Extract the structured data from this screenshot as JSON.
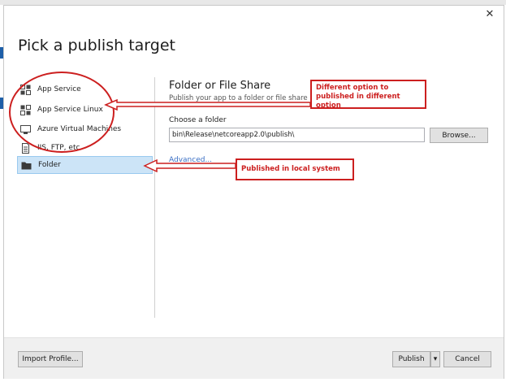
{
  "dialog": {
    "title": "Pick a publish target",
    "close_glyph": "✕"
  },
  "targets": [
    {
      "label": "App Service",
      "icon": "app-service-icon"
    },
    {
      "label": "App Service Linux",
      "icon": "app-service-linux-icon"
    },
    {
      "label": "Azure Virtual Machines",
      "icon": "virtual-machine-icon"
    },
    {
      "label": "IIS, FTP, etc",
      "icon": "document-icon"
    },
    {
      "label": "Folder",
      "icon": "folder-icon",
      "selected": true
    }
  ],
  "detail": {
    "title": "Folder or File Share",
    "subtitle": "Publish your app to a folder or file share",
    "folder_label": "Choose a folder",
    "folder_value": "bin\\Release\\netcoreapp2.0\\publish\\",
    "browse_label": "Browse...",
    "advanced_label": "Advanced..."
  },
  "footer": {
    "import_label": "Import Profile...",
    "publish_label": "Publish",
    "dropdown_glyph": "▾",
    "cancel_label": "Cancel"
  },
  "annotations": {
    "options_note": "Different option to published in different option",
    "folder_note": "Published in local system"
  },
  "colors": {
    "accent_red": "#cc1f1f",
    "selection": "#cce4f7",
    "link": "#3a6fc4"
  }
}
